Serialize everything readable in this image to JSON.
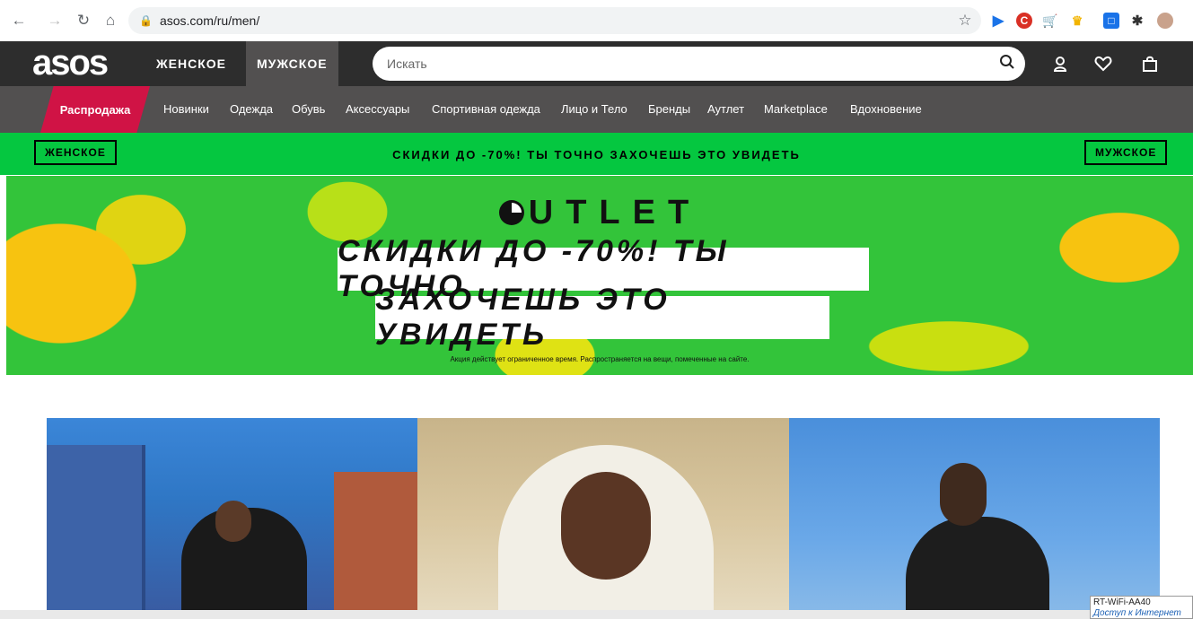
{
  "browser": {
    "url": "asos.com/ru/men/"
  },
  "header": {
    "logo": "asos",
    "women_tab": "ЖЕНСКОЕ",
    "men_tab": "МУЖСКОЕ",
    "search_placeholder": "Искать"
  },
  "nav": {
    "sale": "Распродажа",
    "items": [
      "Новинки",
      "Одежда",
      "Обувь",
      "Аксессуары",
      "Спортивная одежда",
      "Лицо и Тело",
      "Бренды",
      "Аутлет",
      "Marketplace",
      "Вдохновение"
    ]
  },
  "promo": {
    "left_button": "ЖЕНСКОЕ",
    "text": "СКИДКИ ДО -70%! ТЫ ТОЧНО ЗАХОЧЕШЬ ЭТО УВИДЕТЬ",
    "right_button": "МУЖСКОЕ"
  },
  "hero": {
    "title": "UTLET",
    "line1": "СКИДКИ ДО -70%! ТЫ ТОЧНО",
    "line2": "ЗАХОЧЕШЬ ЭТО УВИДЕТЬ",
    "disclaimer": "Акция действует ограниченное время. Распространяется на вещи, помеченные на сайте."
  },
  "tooltip": {
    "line1": "RT-WiFi-AA40",
    "line2": "Доступ к Интернет"
  },
  "colors": {
    "header": "#2d2d2d",
    "nav": "#525050",
    "sale": "#d01345",
    "promo": "#05c740"
  }
}
